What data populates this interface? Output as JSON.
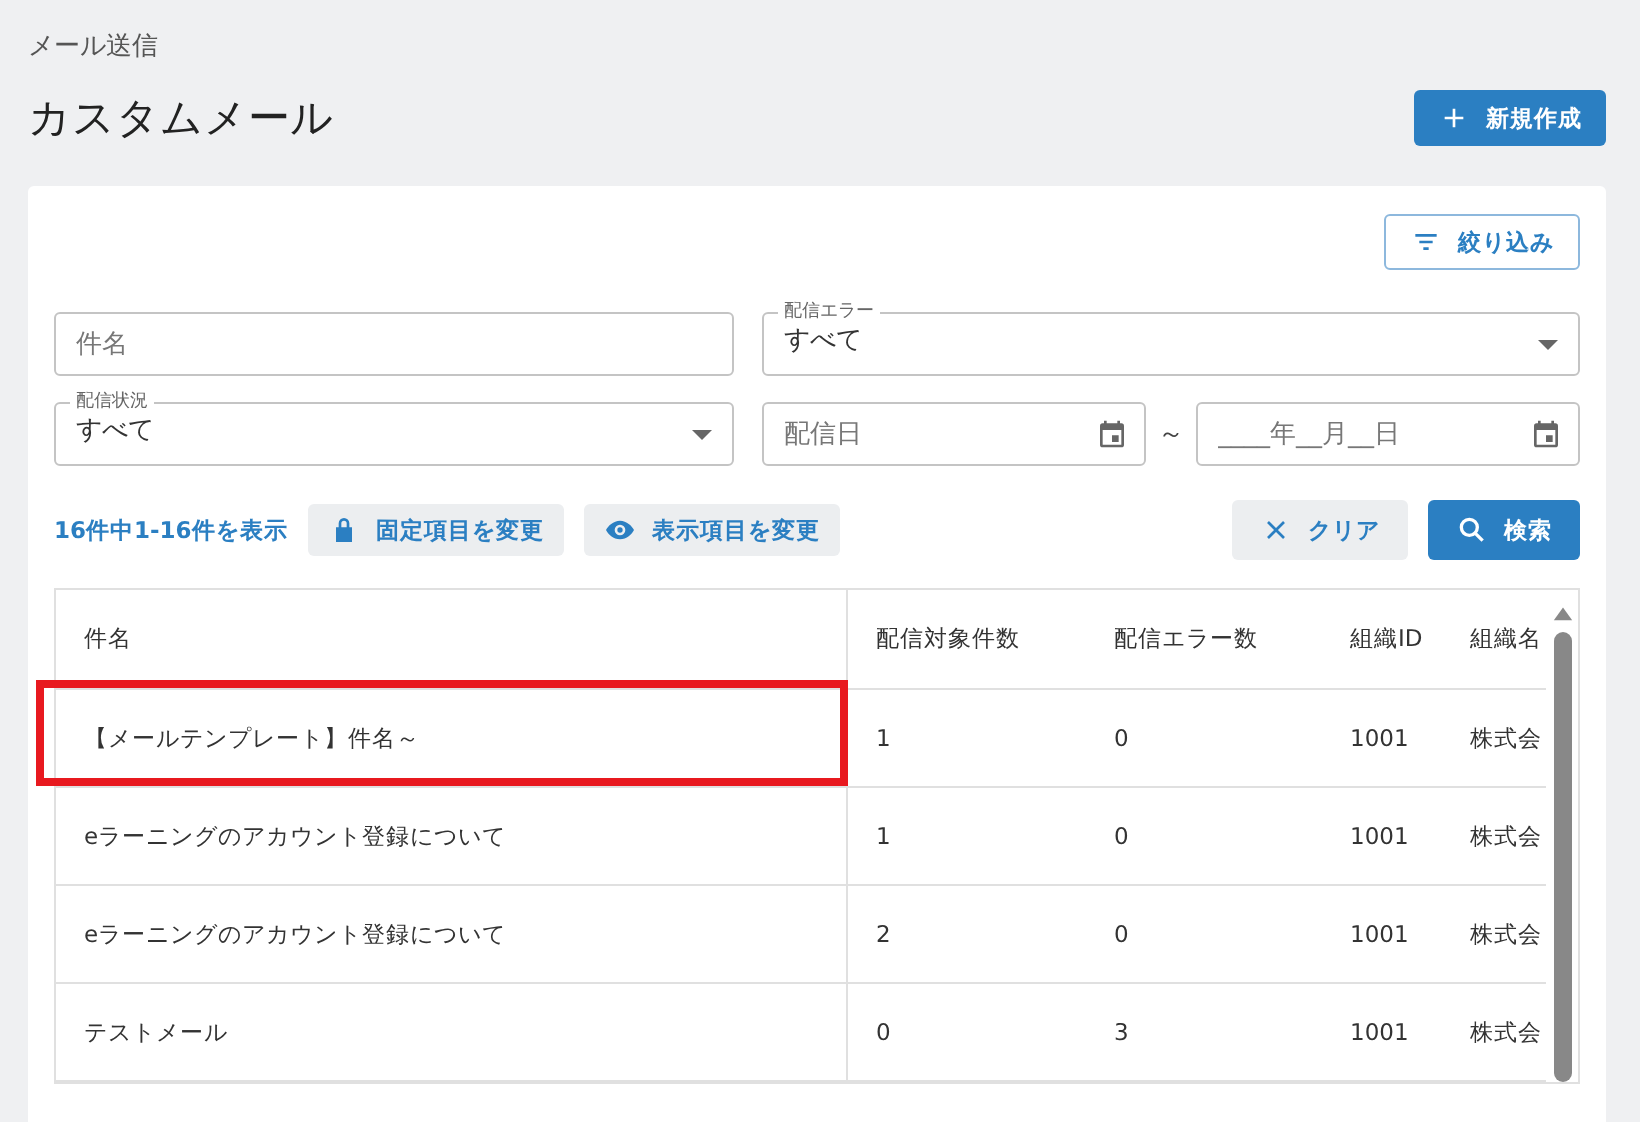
{
  "breadcrumb": "メール送信",
  "title": "カスタムメール",
  "new_button": "新規作成",
  "filter_button": "絞り込み",
  "filters": {
    "subject": {
      "placeholder": "件名"
    },
    "delivery_error": {
      "label": "配信エラー",
      "value": "すべて"
    },
    "delivery_status": {
      "label": "配信状況",
      "value": "すべて"
    },
    "date_from": {
      "placeholder": "配信日"
    },
    "range_sep": "～",
    "date_to": {
      "placeholder": "____年__月__日"
    }
  },
  "result_count": "16件中1-16件を表示",
  "fixed_columns_button": "固定項目を変更",
  "visible_columns_button": "表示項目を変更",
  "clear_button": "クリア",
  "search_button": "検索",
  "table": {
    "columns": [
      "件名",
      "配信対象件数",
      "配信エラー数",
      "組織ID",
      "組織名"
    ],
    "rows": [
      {
        "cells": [
          "【メールテンプレート】件名～",
          "1",
          "0",
          "1001",
          "株式会"
        ],
        "highlighted": true
      },
      {
        "cells": [
          "eラーニングのアカウント登録について",
          "1",
          "0",
          "1001",
          "株式会"
        ],
        "highlighted": false
      },
      {
        "cells": [
          "eラーニングのアカウント登録について",
          "2",
          "0",
          "1001",
          "株式会"
        ],
        "highlighted": false
      },
      {
        "cells": [
          "テストメール",
          "0",
          "3",
          "1001",
          "株式会"
        ],
        "highlighted": false
      }
    ]
  }
}
